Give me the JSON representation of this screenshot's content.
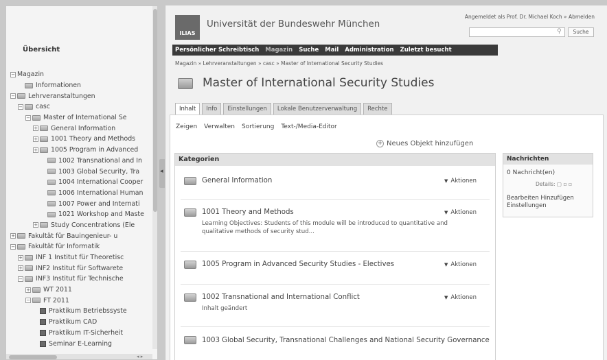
{
  "left_panel": {
    "title": "Übersicht",
    "tree": [
      {
        "indent": 0,
        "exp": "−",
        "icon": "none",
        "label": "Magazin"
      },
      {
        "indent": 1,
        "exp": "",
        "icon": "folder",
        "label": "Informationen"
      },
      {
        "indent": 0,
        "exp": "−",
        "icon": "folder",
        "label": "Lehrveranstaltungen"
      },
      {
        "indent": 1,
        "exp": "−",
        "icon": "folder",
        "label": "casc"
      },
      {
        "indent": 2,
        "exp": "−",
        "icon": "folder",
        "label": "Master of International Se"
      },
      {
        "indent": 3,
        "exp": "+",
        "icon": "folder",
        "label": "General Information"
      },
      {
        "indent": 3,
        "exp": "+",
        "icon": "folder",
        "label": "1001 Theory and Methods"
      },
      {
        "indent": 3,
        "exp": "+",
        "icon": "folder",
        "label": "1005 Program in Advanced"
      },
      {
        "indent": 4,
        "exp": "",
        "icon": "folder",
        "label": "1002 Transnational and In"
      },
      {
        "indent": 4,
        "exp": "",
        "icon": "folder",
        "label": "1003 Global Security, Tra"
      },
      {
        "indent": 4,
        "exp": "",
        "icon": "folder",
        "label": "1004 International Cooper"
      },
      {
        "indent": 4,
        "exp": "",
        "icon": "folder",
        "label": "1006 International Human"
      },
      {
        "indent": 4,
        "exp": "",
        "icon": "folder",
        "label": "1007 Power and Internati"
      },
      {
        "indent": 4,
        "exp": "",
        "icon": "folder",
        "label": "1021 Workshop and Maste"
      },
      {
        "indent": 3,
        "exp": "+",
        "icon": "folder",
        "label": "Study Concentrations (Ele"
      },
      {
        "indent": 0,
        "exp": "+",
        "icon": "folder",
        "label": "Fakultät für Bauingenieur- u"
      },
      {
        "indent": 0,
        "exp": "−",
        "icon": "folder",
        "label": "Fakultät für Informatik"
      },
      {
        "indent": 1,
        "exp": "+",
        "icon": "folder",
        "label": "INF 1 Institut für Theoretisc"
      },
      {
        "indent": 1,
        "exp": "+",
        "icon": "folder",
        "label": "INF2 Institut für Softwarete"
      },
      {
        "indent": 1,
        "exp": "−",
        "icon": "folder",
        "label": "INF3 Institut für Technische"
      },
      {
        "indent": 2,
        "exp": "+",
        "icon": "folder",
        "label": "WT 2011"
      },
      {
        "indent": 2,
        "exp": "−",
        "icon": "folder",
        "label": "FT 2011"
      },
      {
        "indent": 3,
        "exp": "",
        "icon": "object",
        "label": "Praktikum Betriebssyste"
      },
      {
        "indent": 3,
        "exp": "",
        "icon": "object",
        "label": "Praktikum CAD"
      },
      {
        "indent": 3,
        "exp": "",
        "icon": "object",
        "label": "Praktikum IT-Sicherheit"
      },
      {
        "indent": 3,
        "exp": "",
        "icon": "object",
        "label": "Seminar E-Learning"
      }
    ]
  },
  "header": {
    "logo": "ILIAS",
    "university": "Universität der Bundeswehr München",
    "login": "Angemeldet als Prof. Dr. Michael Koch » Abmelden",
    "search_button": "Suche"
  },
  "menu": [
    {
      "label": "Persönlicher Schreibtisch",
      "dim": false
    },
    {
      "label": "Magazin",
      "dim": true
    },
    {
      "label": "Suche",
      "dim": false
    },
    {
      "label": "Mail",
      "dim": false
    },
    {
      "label": "Administration",
      "dim": false
    },
    {
      "label": "Zuletzt besucht",
      "dim": false
    }
  ],
  "breadcrumb": "Magazin » Lehrveranstaltungen » casc » Master of International Security Studies",
  "page_title": "Master of International Security Studies",
  "tabs": [
    {
      "label": "Inhalt",
      "active": true
    },
    {
      "label": "Info",
      "active": false
    },
    {
      "label": "Einstellungen",
      "active": false
    },
    {
      "label": "Lokale Benutzerverwaltung",
      "active": false
    },
    {
      "label": "Rechte",
      "active": false
    }
  ],
  "subtabs": [
    "Zeigen",
    "Verwalten",
    "Sortierung",
    "Text-/Media-Editor"
  ],
  "new_object": "Neues Objekt hinzufügen",
  "categories": {
    "header": "Kategorien",
    "actions_label": "Aktionen",
    "items": [
      {
        "name": "General Information",
        "desc": "",
        "has_action": true
      },
      {
        "name": "1001 Theory and Methods",
        "desc": "Learning Objectives: Students of this module will be introduced to quantitative and qualitative methods of security stud...",
        "has_action": true
      },
      {
        "name": "1005 Program in Advanced Security Studies - Electives",
        "desc": "",
        "has_action": true
      },
      {
        "name": "1002 Transnational and International Conflict",
        "desc": "Inhalt geändert",
        "has_action": true
      },
      {
        "name": "1003 Global Security, Transnational Challenges and National Security Governance",
        "desc": "",
        "has_action": false
      }
    ]
  },
  "news": {
    "header": "Nachrichten",
    "count": "0 Nachricht(en)",
    "details": "Details:",
    "links": "Bearbeiten Hinzufügen Einstellungen"
  }
}
